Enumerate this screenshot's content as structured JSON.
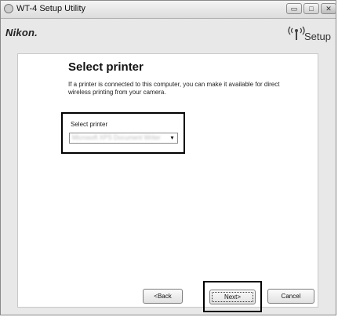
{
  "window": {
    "title": "WT-4 Setup Utility",
    "controls": {
      "minimize": "▭",
      "maximize": "□",
      "close": "✕"
    }
  },
  "header": {
    "brand": "Nikon.",
    "logo_text": "Setup",
    "logo_icon": "wireless-antenna-icon"
  },
  "page": {
    "heading": "Select printer",
    "description": "If a printer is connected to this computer, you can make it available for direct wireless printing from your camera.",
    "select_label": "Select printer",
    "select_value": "Microsoft XPS Document Writer",
    "select_arrow": "▾"
  },
  "buttons": {
    "back": "<Back",
    "next": "Next>",
    "cancel": "Cancel"
  }
}
